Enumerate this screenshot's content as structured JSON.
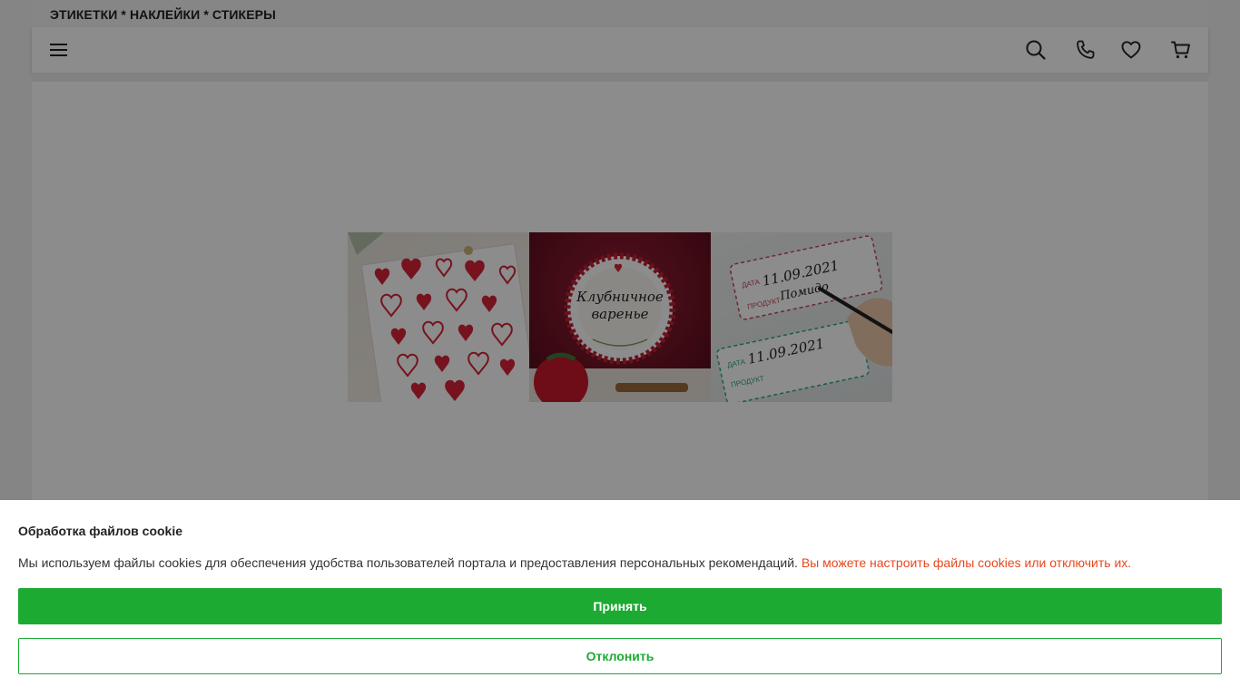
{
  "header": {
    "brand_text": "ЭТИКЕТКИ * НАКЛЕЙКИ * СТИКЕРЫ",
    "icons": [
      "menu-icon",
      "search-icon",
      "phone-icon",
      "heart-icon",
      "cart-icon"
    ]
  },
  "banner": {
    "jam_label": "Клубничное\nваренье",
    "tag1": {
      "date_caption": "ДАТА",
      "date": "11.09.2021",
      "product_caption": "ПРОДУКТ",
      "product": "Помидо"
    },
    "tag2": {
      "date_caption": "ДАТА",
      "date": "11.09.2021",
      "product_caption": "ПРОДУКТ"
    }
  },
  "cookie": {
    "title": "Обработка файлов cookie",
    "text": "Мы используем файлы cookies для обеспечения удобства пользователей портала и предоставления персональных рекомендаций.",
    "link_text": "Вы можете настроить файлы cookies или отключить их.",
    "accept_label": "Принять",
    "decline_label": "Отклонить"
  },
  "colors": {
    "accent_green": "#1daa33",
    "link_orange": "#e8481c",
    "heart_red": "#d8233a"
  }
}
